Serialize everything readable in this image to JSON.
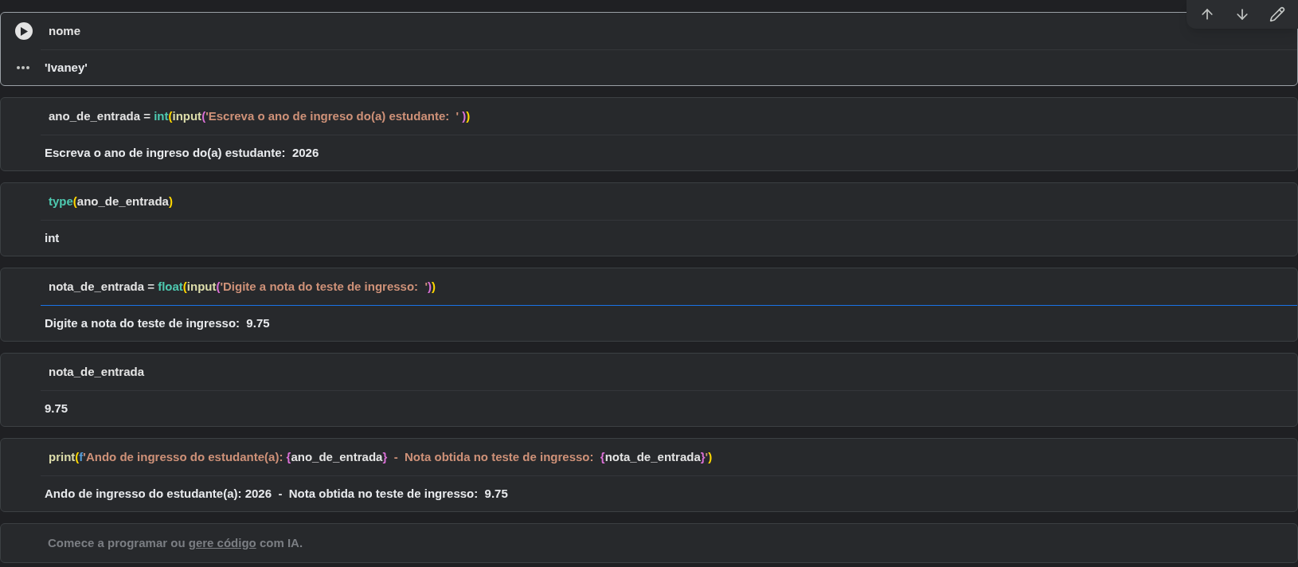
{
  "toolbar": {
    "buttons": [
      {
        "kind": "up"
      },
      {
        "kind": "down"
      },
      {
        "kind": "ai-edit"
      }
    ]
  },
  "cells": [
    {
      "selected": true,
      "focused": false,
      "code": [
        {
          "kind": "plain",
          "text": "nome"
        }
      ],
      "output": "'Ivaney'"
    },
    {
      "selected": false,
      "focused": false,
      "code": [
        {
          "kind": "plain",
          "text": "ano_de_entrada = "
        },
        {
          "kind": "builtin",
          "text": "int"
        },
        {
          "kind": "paren1",
          "text": "("
        },
        {
          "kind": "call",
          "text": "input"
        },
        {
          "kind": "paren2",
          "text": "("
        },
        {
          "kind": "string",
          "text": "'Escreva o ano de ingreso do(a) estudante:  ' "
        },
        {
          "kind": "paren2",
          "text": ")"
        },
        {
          "kind": "paren1",
          "text": ")"
        }
      ],
      "output": "Escreva o ano de ingreso do(a) estudante:  2026"
    },
    {
      "selected": false,
      "focused": false,
      "code": [
        {
          "kind": "builtin",
          "text": "type"
        },
        {
          "kind": "paren1",
          "text": "("
        },
        {
          "kind": "plain",
          "text": "ano_de_entrada"
        },
        {
          "kind": "paren1",
          "text": ")"
        }
      ],
      "output": "int"
    },
    {
      "selected": false,
      "focused": true,
      "code": [
        {
          "kind": "plain",
          "text": "nota_de_entrada = "
        },
        {
          "kind": "builtin",
          "text": "float"
        },
        {
          "kind": "paren1",
          "text": "("
        },
        {
          "kind": "call",
          "text": "input"
        },
        {
          "kind": "paren2",
          "text": "("
        },
        {
          "kind": "string",
          "text": "'Digite a nota do teste de ingresso:  '"
        },
        {
          "kind": "paren2",
          "text": ")"
        },
        {
          "kind": "paren1",
          "text": ")"
        }
      ],
      "output": "Digite a nota do teste de ingresso:  9.75"
    },
    {
      "selected": false,
      "focused": false,
      "code": [
        {
          "kind": "plain",
          "text": "nota_de_entrada"
        }
      ],
      "output": "9.75"
    },
    {
      "selected": false,
      "focused": false,
      "code": [
        {
          "kind": "call",
          "text": "print"
        },
        {
          "kind": "paren1",
          "text": "("
        },
        {
          "kind": "prefix",
          "text": "f"
        },
        {
          "kind": "string",
          "text": "'Ando de ingresso do estudante(a): "
        },
        {
          "kind": "paren2",
          "text": "{"
        },
        {
          "kind": "plain",
          "text": "ano_de_entrada"
        },
        {
          "kind": "paren2",
          "text": "}"
        },
        {
          "kind": "string",
          "text": "  -  Nota obtida no teste de ingresso:  "
        },
        {
          "kind": "paren2",
          "text": "{"
        },
        {
          "kind": "plain",
          "text": "nota_de_entrada"
        },
        {
          "kind": "paren2",
          "text": "}"
        },
        {
          "kind": "string",
          "text": "'"
        },
        {
          "kind": "paren1",
          "text": ")"
        }
      ],
      "output": "Ando de ingresso do estudante(a): 2026  -  Nota obtida no teste de ingresso:  9.75"
    }
  ],
  "empty_cell": {
    "placeholder_before": "Comece a programar ou ",
    "placeholder_link": "gere código",
    "placeholder_after": " com IA."
  }
}
